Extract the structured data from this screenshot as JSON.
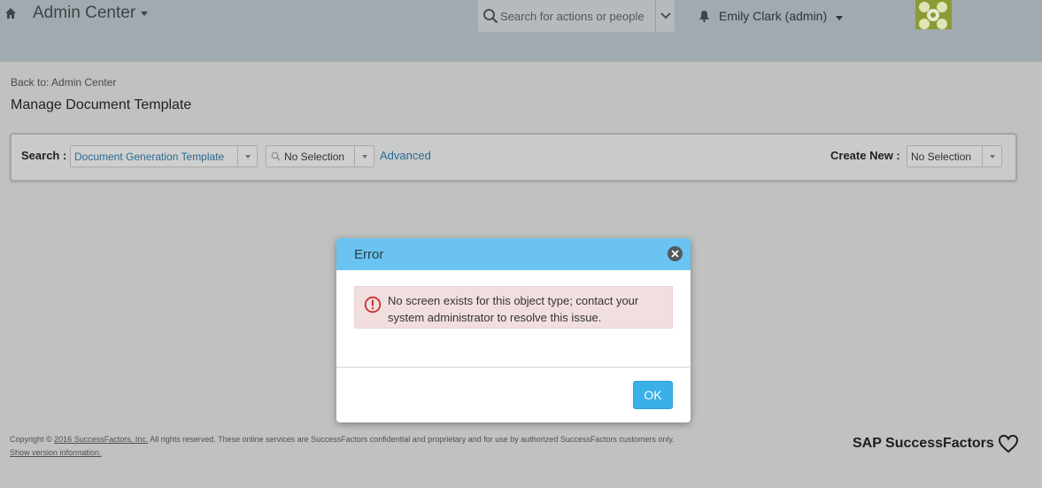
{
  "header": {
    "app_title": "Admin Center",
    "search_placeholder": "Search for actions or people",
    "user_name": "Emily Clark (admin)"
  },
  "page": {
    "back_link": "Back to: Admin Center",
    "title": "Manage Document Template"
  },
  "search_panel": {
    "search_label": "Search :",
    "template_select": "Document Generation Template",
    "filter_select": "No Selection",
    "advanced_link": "Advanced",
    "create_label": "Create New :",
    "create_select": "No Selection"
  },
  "dialog": {
    "title": "Error",
    "message": "No screen exists for this object type; contact your system administrator to resolve this issue.",
    "ok_label": "OK"
  },
  "footer": {
    "copyright_prefix": "Copyright ©",
    "copyright_link": "2016 SuccessFactors, Inc.",
    "copyright_rest": "All rights reserved. These online services are SuccessFactors confidential and proprietary and for use by authorized SuccessFactors customers only.",
    "version_link": "Show version information.",
    "brand": "SAP SuccessFactors"
  },
  "icons": {
    "home": "home-icon",
    "search": "search-icon",
    "bell": "bell-icon",
    "close": "close-icon",
    "error": "error-icon",
    "heart": "heart-icon"
  },
  "colors": {
    "dialog_header": "#6ac3f0",
    "ok_button": "#3bb0e8",
    "error_background": "#f1dfdf",
    "error_icon": "#c9302c",
    "link": "#2a6c93"
  }
}
